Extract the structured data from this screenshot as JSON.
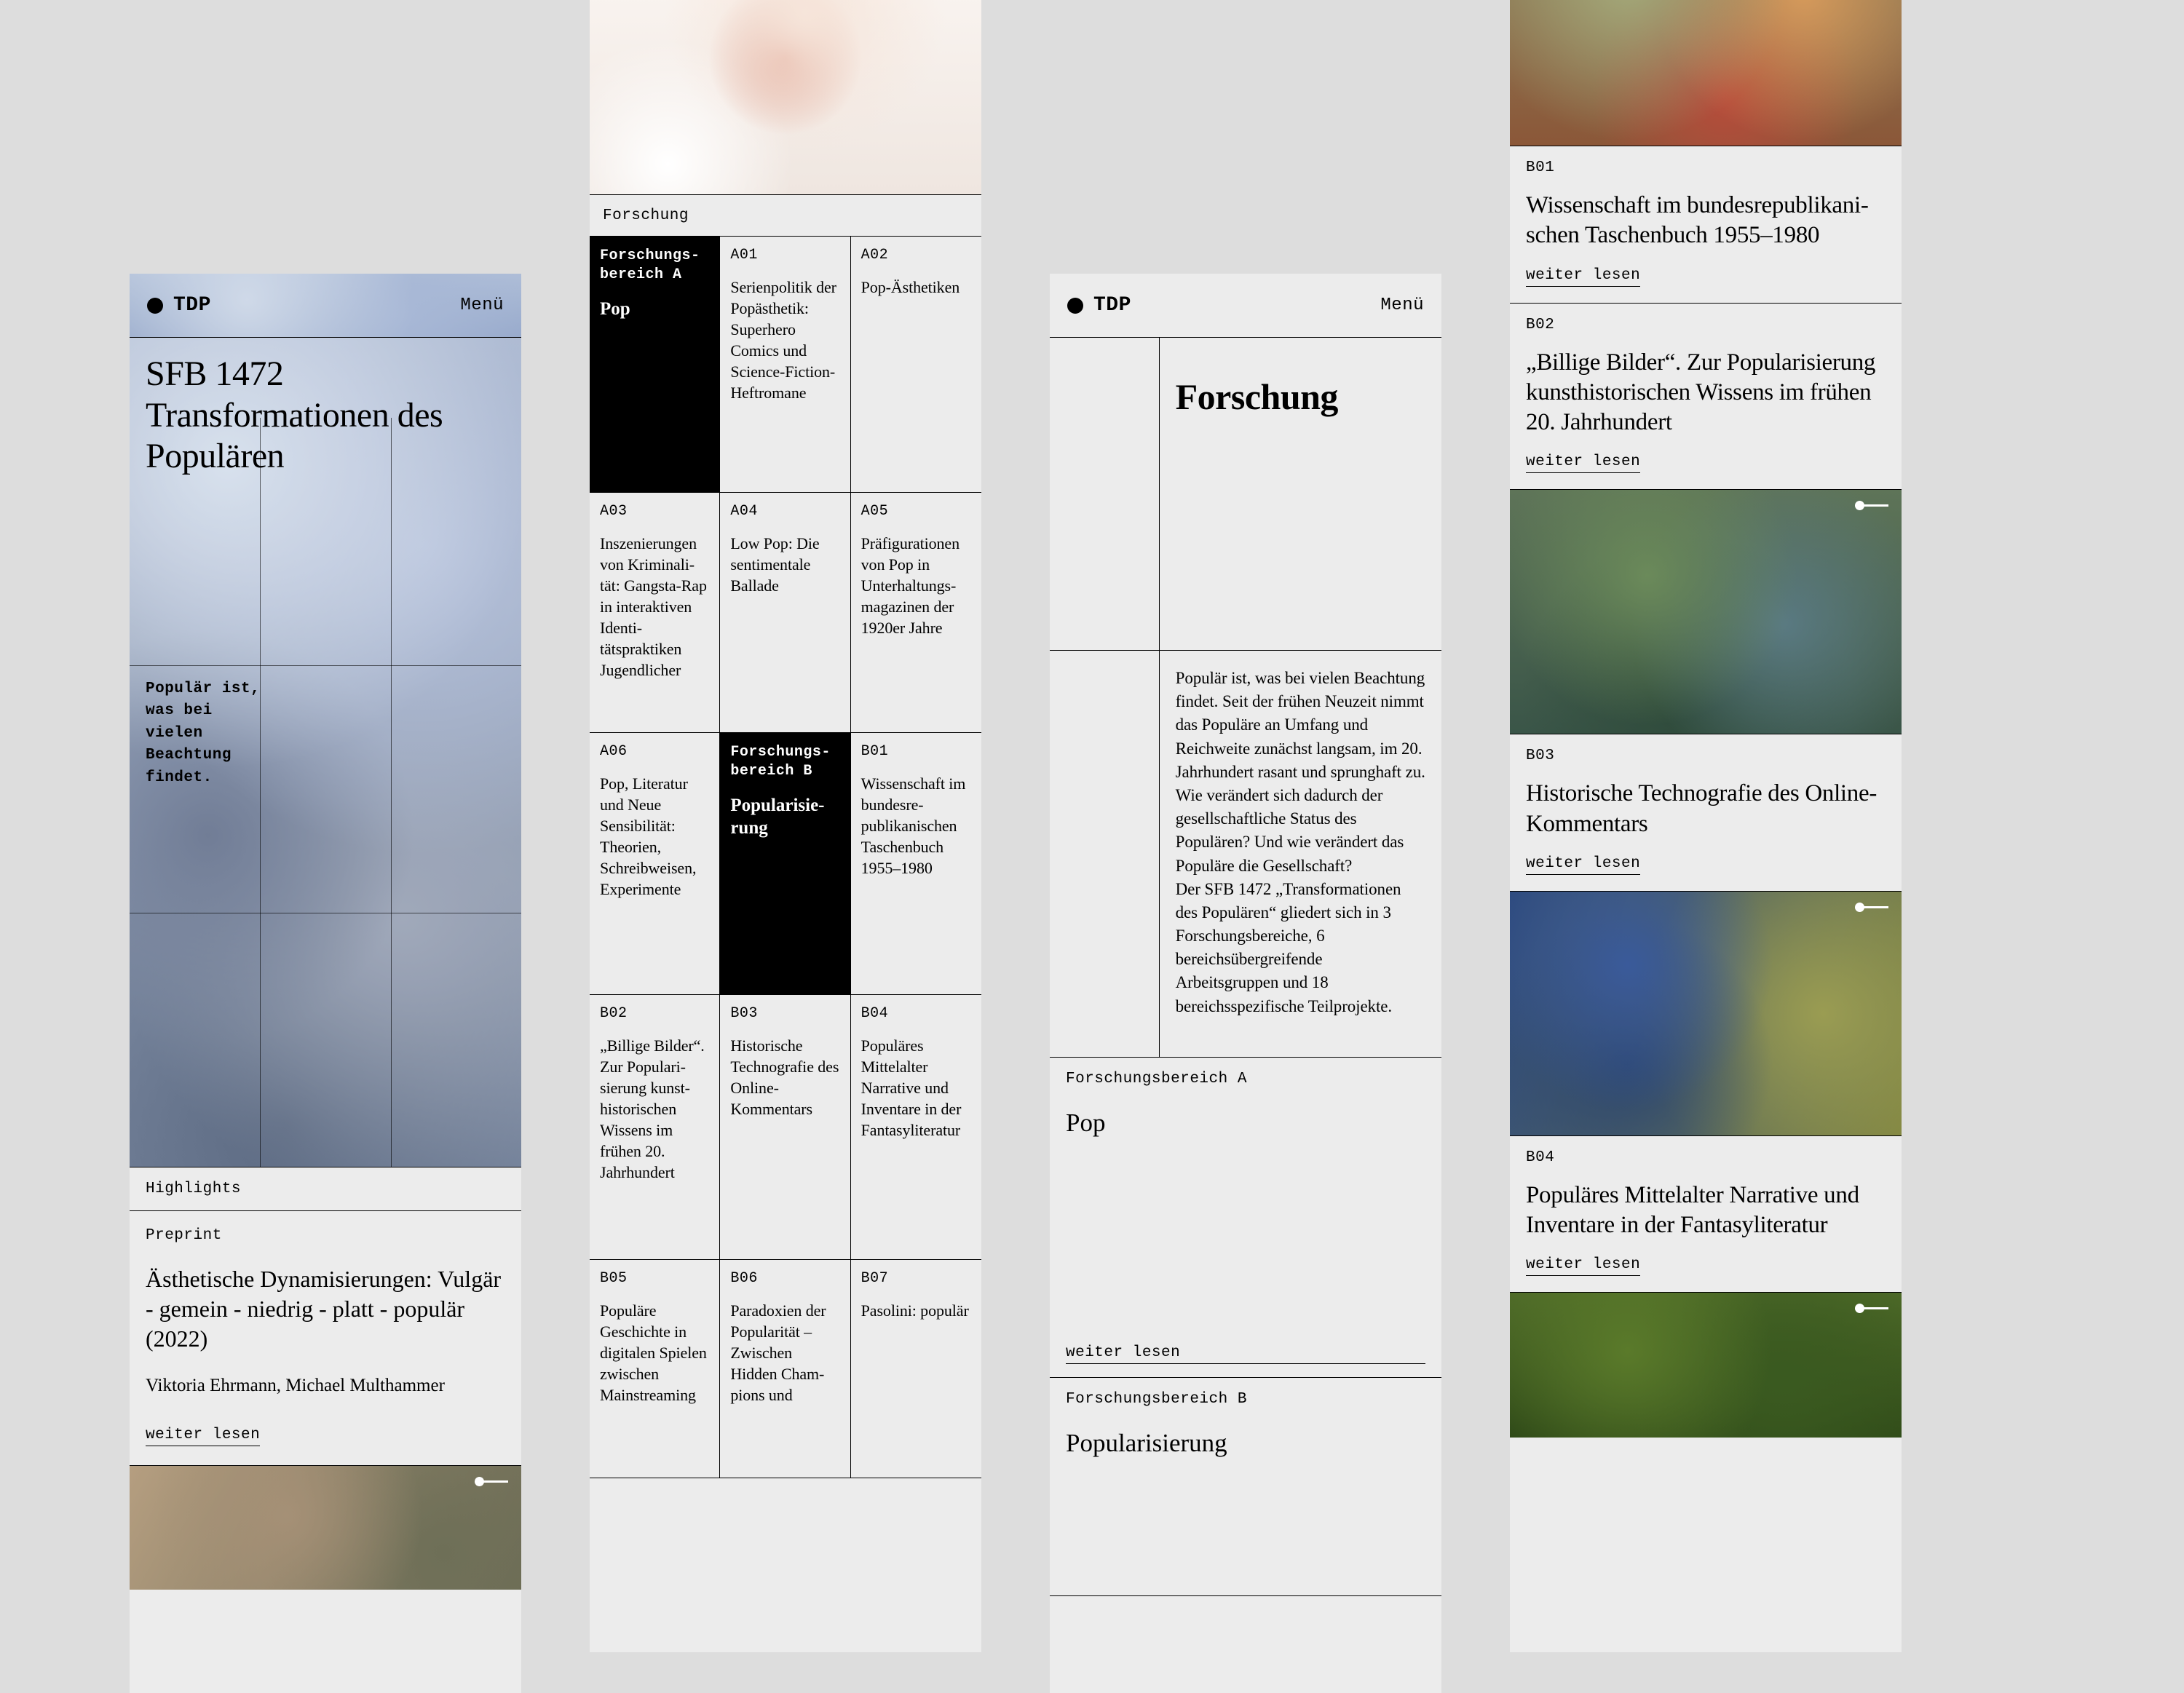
{
  "brand": "TDP",
  "menu_label": "Menü",
  "hero": {
    "title": "SFB 1472 Transformationen des Populären",
    "tagline_bold": "Populär ist, was bei vielen Beachtung findet."
  },
  "highlights_label": "Highlights",
  "highlight_card": {
    "kicker": "Preprint",
    "title": "Ästhetische Dynamisierungen: Vulgär - gemein - niedrig - platt - populär (2022)",
    "authors": "Viktoria Ehrmann, Michael Multhammer",
    "readmore": "weiter lesen"
  },
  "col2": {
    "section_label": "Forschung",
    "areaA_label": "Forschungs-\nbereich A",
    "areaA_name": "Pop",
    "areaB_label": "Forschungs-\nbereich B",
    "areaB_name": "Popularisie-\nrung",
    "cells": [
      {
        "code": "A01",
        "text": "Serienpolitik der Popästhe­tik: Superhero Comics und Science-Fiction-Heftro­mane"
      },
      {
        "code": "A02",
        "text": "Pop-Ästheti­ken"
      },
      {
        "code": "A03",
        "text": "Inszenierungen von Kriminali­tät: Gangsta-Rap in interak­tiven Identi­tätspraktiken Jugendlicher"
      },
      {
        "code": "A04",
        "text": "Low Pop: Die sentimentale Ballade"
      },
      {
        "code": "A05",
        "text": "Präfiguratio­nen von Pop in Unterhaltungs­magazinen der 1920er Jahre"
      },
      {
        "code": "A06",
        "text": "Pop, Literatur und Neue Sensibilität: Theorien, Schreibweisen, Experimente"
      },
      {
        "code": "B01",
        "text": "Wissenschaft im bundesre­publikanischen Taschenbuch 1955–1980"
      },
      {
        "code": "B02",
        "text": "„Billige Bilder“. Zur Populari­sierung kunst­historischen Wissens im frühen 20. Jahrhundert"
      },
      {
        "code": "B03",
        "text": "Historische Technografie des Online-Kommentars"
      },
      {
        "code": "B04",
        "text": "Populäres Mittelalter Narrative und Inventare in der Fantasylitera­tur"
      },
      {
        "code": "B05",
        "text": "Populäre Geschichte in digitalen Spie­len zwischen Mainstreaming"
      },
      {
        "code": "B06",
        "text": "Paradoxien der Popularität – Zwischen Hidden Cham­pions und"
      },
      {
        "code": "B07",
        "text": "Pasolini: popu­lär"
      }
    ]
  },
  "col3": {
    "heading": "Forschung",
    "body": "Populär ist, was bei vielen Beachtung findet. Seit der frühen Neuzeit nimmt das Populäre an Umfang und Reichweite zunächst langsam, im 20. Jahrhundert rasant und sprunghaft zu.\nWie verändert sich dadurch der gesellschaftliche Status des Populären? Und wie verändert das Populäre die Gesellschaft?\nDer SFB 1472 „Transformationen des Populären“ gliedert sich in 3 Forschungsbereiche, 6 bereichsübergreifende Arbeitsgruppen und 18 bereichsspezifische Teilprojekte.",
    "blockA_kicker": "Forschungsbereich A",
    "blockA_title": "Pop",
    "blockB_kicker": "Forschungsbereich B",
    "blockB_title": "Popularisierung",
    "readmore": "weiter lesen"
  },
  "col4": {
    "readmore": "weiter lesen",
    "cards": [
      {
        "code": "B01",
        "title": "Wissenschaft im bundesrepublikani­schen Taschenbuch 1955–1980"
      },
      {
        "code": "B02",
        "title": "„Billige Bilder“. Zur Popularisierung kunsthistorischen Wissens im frühen 20. Jahrhundert"
      },
      {
        "code": "B03",
        "title": "Historische Technografie des Online-Kommentars"
      },
      {
        "code": "B04",
        "title": "Populäres Mittelalter Narrative und Inventare in der Fantasyliteratur"
      }
    ]
  }
}
